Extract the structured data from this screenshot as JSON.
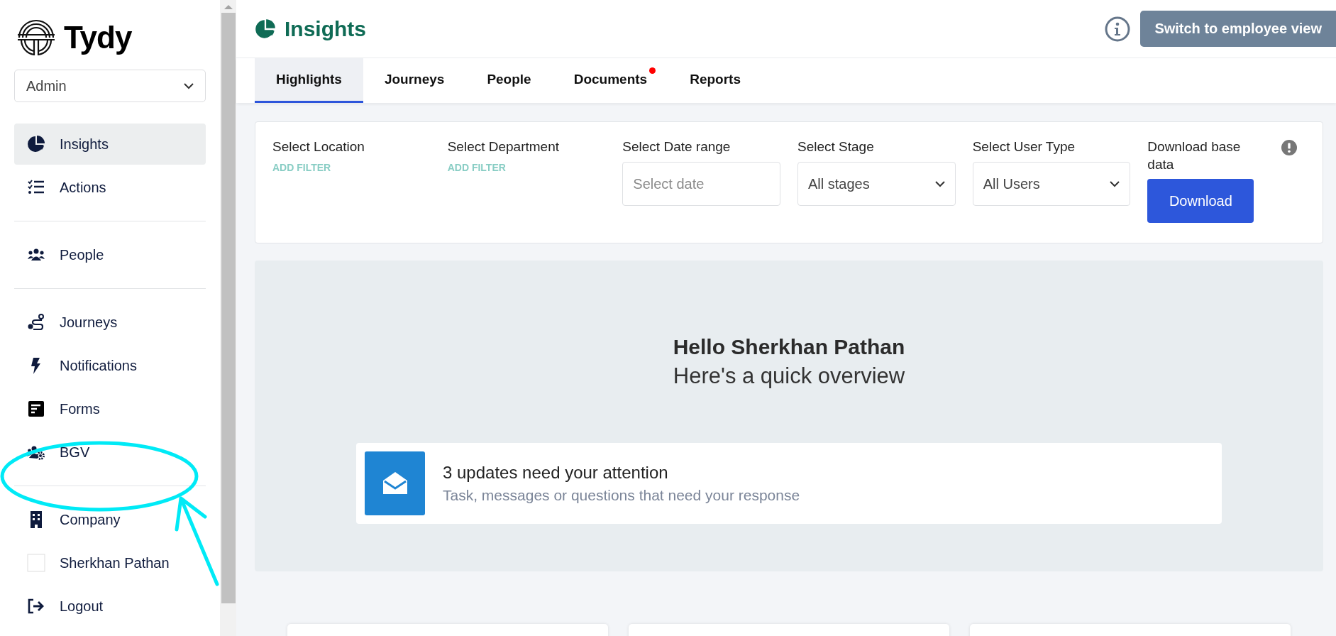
{
  "sidebar": {
    "brand": "Tydy",
    "role_select": {
      "value": "Admin"
    },
    "sections": [
      [
        {
          "label": "Insights",
          "selected": true
        },
        {
          "label": "Actions",
          "selected": false
        }
      ],
      [
        {
          "label": "People",
          "selected": false
        }
      ],
      [
        {
          "label": "Journeys",
          "selected": false
        },
        {
          "label": "Notifications",
          "selected": false
        },
        {
          "label": "Forms",
          "selected": false
        },
        {
          "label": "BGV",
          "selected": false
        }
      ],
      [
        {
          "label": "Company",
          "selected": false
        },
        {
          "label": "Sherkhan Pathan",
          "selected": false
        },
        {
          "label": "Logout",
          "selected": false
        }
      ]
    ]
  },
  "header": {
    "title": "Insights",
    "switch_button": "Switch to employee view"
  },
  "tabs": [
    {
      "label": "Highlights",
      "selected": true,
      "notification": false
    },
    {
      "label": "Journeys",
      "selected": false,
      "notification": false
    },
    {
      "label": "People",
      "selected": false,
      "notification": false
    },
    {
      "label": "Documents",
      "selected": false,
      "notification": true
    },
    {
      "label": "Reports",
      "selected": false,
      "notification": false
    }
  ],
  "filters": [
    {
      "kind": "add_filter",
      "label": "Select Location",
      "link": "ADD FILTER"
    },
    {
      "kind": "add_filter",
      "label": "Select Department",
      "link": "ADD FILTER"
    },
    {
      "kind": "date",
      "label": "Select Date range",
      "placeholder": "Select date"
    },
    {
      "kind": "select",
      "label": "Select Stage",
      "value": "All stages"
    },
    {
      "kind": "select",
      "label": "Select User Type",
      "value": "All Users"
    },
    {
      "kind": "download",
      "label": "Download base data",
      "button": "Download"
    }
  ],
  "overview": {
    "greeting": "Hello Sherkhan Pathan",
    "subtitle": "Here's a quick overview",
    "update": {
      "title": "3 updates need your attention",
      "description": "Task, messages or questions that need your response"
    }
  },
  "annotations": [
    {
      "kind": "ellipse"
    },
    {
      "kind": "arrow"
    }
  ]
}
